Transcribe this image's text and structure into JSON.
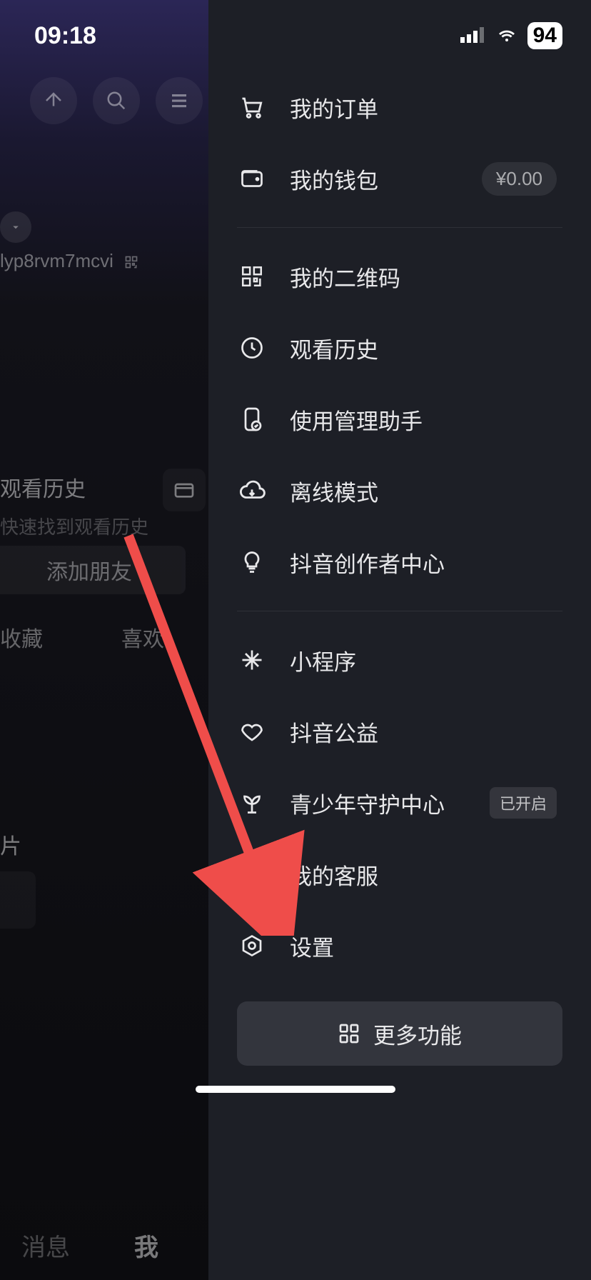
{
  "statusbar": {
    "time": "09:18",
    "battery": "94"
  },
  "underlay": {
    "username": "lyp8rvm7mcvi",
    "history_title": "观看历史",
    "history_sub": "快速找到观看历史",
    "add_friend": "添加朋友",
    "tab_collect": "收藏",
    "tab_like": "喜欢",
    "pian": "片",
    "bottom_tab_msg": "消息",
    "bottom_tab_me": "我"
  },
  "menu": {
    "orders": "我的订单",
    "wallet": "我的钱包",
    "wallet_amount": "¥0.00",
    "qr": "我的二维码",
    "history": "观看历史",
    "assistant": "使用管理助手",
    "offline": "离线模式",
    "creator": "抖音创作者中心",
    "miniapp": "小程序",
    "charity": "抖音公益",
    "youth": "青少年守护中心",
    "youth_badge": "已开启",
    "support": "我的客服",
    "settings": "设置",
    "more": "更多功能"
  }
}
